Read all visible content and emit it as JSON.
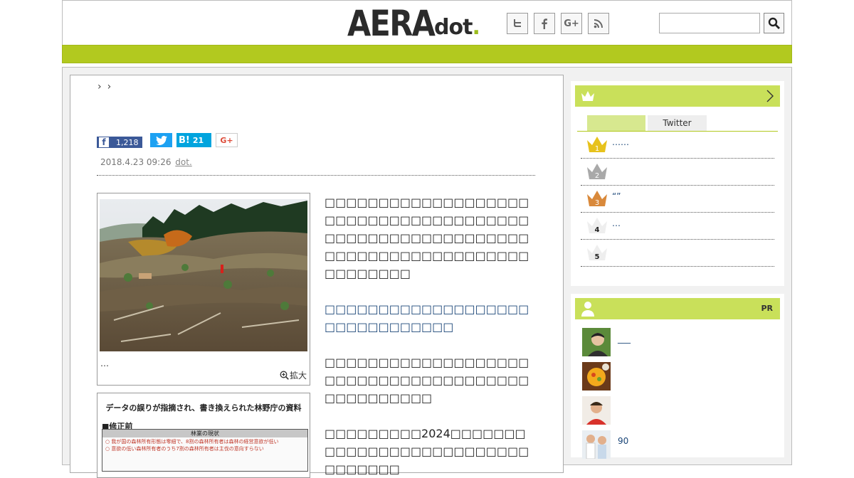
{
  "header": {
    "logo_main": "AERA",
    "logo_dot": "dot",
    "logo_period": ".",
    "social": [
      "twitter-icon",
      "facebook-icon",
      "googleplus-icon",
      "rss-icon"
    ],
    "search_placeholder": ""
  },
  "colors": {
    "brand_green": "#b2c91f",
    "head_green": "#c9e05a",
    "link_blue": "#1a4577"
  },
  "breadcrumb": [
    "›",
    "›"
  ],
  "share": {
    "facebook_count": "1,218",
    "hatena_label": "B!",
    "hatena_count": "21",
    "googleplus_label": "G+"
  },
  "article": {
    "date": "2018.4.23 09:26",
    "source": "dot.",
    "photo_caption": "…",
    "zoom_label": "拡大",
    "doc_title": "データの誤りが指摘され、書き換えられた林野庁の資料",
    "doc_subtitle": "■修正前",
    "doc_table_header": "林業の現状",
    "doc_rows": [
      "○ 我が国の森林所有形態は零細で、8割の森林所有者は森林の経営意欲が低い",
      "○ 意欲の低い森林所有者のうち7割の森林所有者は主伐の意向すらない"
    ],
    "paragraph1": "□□□□□□□□□□□□□□□□□□□□□□□□□□□□□□□□□□□□□□□□□□□□□□□□□□□□□□□□□□□□□□□□□□□□□□□□□□□□□□□□□□□□",
    "paragraph2": "□□□□□□□□□□□□□□□□□□□□□□□□□□□□□□□",
    "paragraph3": "□□□□□□□□□□□□□□□□□□□□□□□□□□□□□□□□□□□□□□□□□□□□□□□□",
    "paragraph4": "□□□□□□□□□2024□□□□□□□□□□□□□□□□□□□□□□□□□□□□□□□□□"
  },
  "ranking": {
    "tab_active": "",
    "tab_twitter": "Twitter",
    "items": [
      {
        "rank": "1",
        "text": "……"
      },
      {
        "rank": "2",
        "text": ""
      },
      {
        "rank": "3",
        "text": "“”"
      },
      {
        "rank": "4",
        "text": "…"
      },
      {
        "rank": "5",
        "text": ""
      }
    ]
  },
  "pr": {
    "label": "PR",
    "items": [
      {
        "text": "___"
      },
      {
        "text": ""
      },
      {
        "text": ""
      },
      {
        "text": "90"
      }
    ]
  }
}
